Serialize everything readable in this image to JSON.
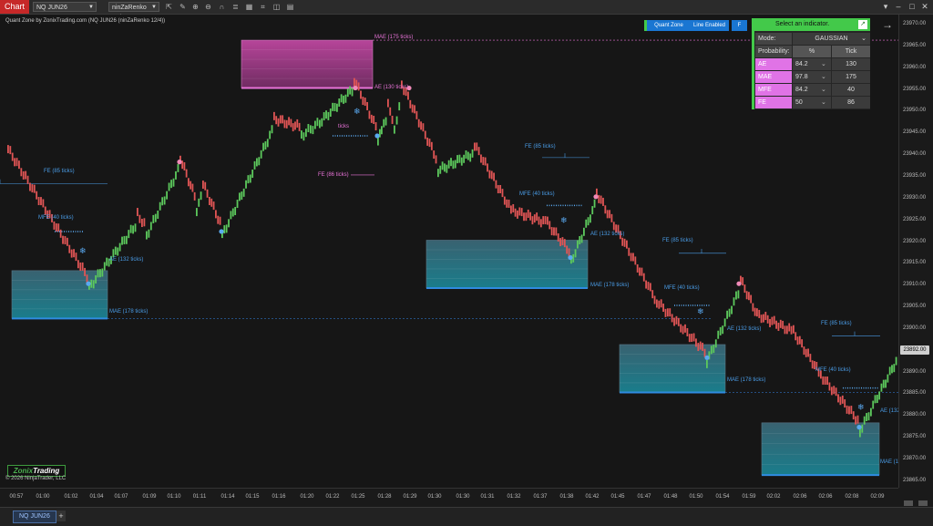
{
  "toolbar": {
    "chart_tab": "Chart",
    "instrument": "NQ JUN26",
    "bar_type": "ninZaRenko 12/4",
    "icons": [
      "cursor-icon",
      "draw-icon",
      "zoom-in-icon",
      "zoom-out-icon",
      "magnet-icon",
      "properties-icon",
      "template-icon",
      "strategy-icon",
      "screenshot-icon",
      "data-box-icon",
      "dropdown-icon",
      "minimize-icon",
      "maximize-icon",
      "close-icon"
    ]
  },
  "chart": {
    "title": "Quant Zone by ZonixTrading.com (NQ JUN26 (ninZaRenko 12/4))",
    "copyright": "© 2026 NinjaTrader, LLC",
    "logo_part1": "Zonix",
    "logo_part2": "Trading",
    "last_price": "23892.00",
    "colors": {
      "up": "#5cc85c",
      "down": "#e05555",
      "zone_blue": "#2e8bd8",
      "zone_pink": "#e873d8",
      "label_blue": "#4a9de8",
      "label_pink": "#e873d8"
    },
    "annotations": [
      {
        "text": "MAE (175 ticks)",
        "color": "pink"
      },
      {
        "text": "AE (130 ticks)",
        "color": "pink"
      },
      {
        "text": "ticks",
        "color": "pink"
      },
      {
        "text": "FE (86 ticks)",
        "color": "pink"
      },
      {
        "text": "FE (85 ticks)",
        "color": "blue"
      },
      {
        "text": "MFE (40 ticks)",
        "color": "blue"
      },
      {
        "text": "AE (132 ticks)",
        "color": "blue"
      },
      {
        "text": "MAE (178 ticks)",
        "color": "blue"
      },
      {
        "text": "FE (85 ticks)",
        "color": "blue"
      },
      {
        "text": "MFE (40 ticks)",
        "color": "blue"
      },
      {
        "text": "AE (132 ticks)",
        "color": "blue"
      },
      {
        "text": "MAE (178 ticks)",
        "color": "blue"
      },
      {
        "text": "FE (85 ticks)",
        "color": "blue"
      },
      {
        "text": "MFE (40 ticks)",
        "color": "blue"
      },
      {
        "text": "AE (132 ticks)",
        "color": "blue"
      },
      {
        "text": "MAE (178 ticks)",
        "color": "blue"
      },
      {
        "text": "FE (85 ticks)",
        "color": "blue"
      },
      {
        "text": "MFE (40 ticks)",
        "color": "blue"
      },
      {
        "text": "AE (132",
        "color": "blue"
      },
      {
        "text": "MAE (1",
        "color": "blue"
      }
    ]
  },
  "y_ticks": [
    "23970.00",
    "23965.00",
    "23960.00",
    "23955.00",
    "23950.00",
    "23945.00",
    "23940.00",
    "23935.00",
    "23930.00",
    "23925.00",
    "23920.00",
    "23915.00",
    "23910.00",
    "23905.00",
    "23900.00",
    "23895.00",
    "23890.00",
    "23885.00",
    "23880.00",
    "23875.00",
    "23870.00",
    "23865.00"
  ],
  "x_ticks": [
    "00:57",
    "01:00",
    "01:02",
    "01:04",
    "01:07",
    "01:09",
    "01:10",
    "01:11",
    "01:14",
    "01:15",
    "01:16",
    "01:20",
    "01:22",
    "01:25",
    "01:28",
    "01:29",
    "01:30",
    "01:30",
    "01:31",
    "01:32",
    "01:37",
    "01:38",
    "01:42",
    "01:45",
    "01:47",
    "01:48",
    "01:50",
    "01:54",
    "01:59",
    "02:02",
    "02:06",
    "02:06",
    "02:08",
    "02:09"
  ],
  "buttons": {
    "quant_zone": "Quant Zone",
    "line_enabled": "Line Enabled",
    "f": "F"
  },
  "panel": {
    "title": "Select an indicator.",
    "mode_label": "Mode:",
    "mode_value": "GAUSSIAN",
    "prob_label": "Probability:",
    "pct_header": "%",
    "tick_header": "Tick",
    "rows": [
      {
        "name": "AE",
        "pct": "84.2",
        "tick": "130"
      },
      {
        "name": "MAE",
        "pct": "97.8",
        "tick": "175"
      },
      {
        "name": "MFE",
        "pct": "84.2",
        "tick": "40"
      },
      {
        "name": "FE",
        "pct": "50",
        "tick": "86"
      }
    ]
  },
  "bottom": {
    "tab": "NQ JUN26",
    "add": "+"
  }
}
